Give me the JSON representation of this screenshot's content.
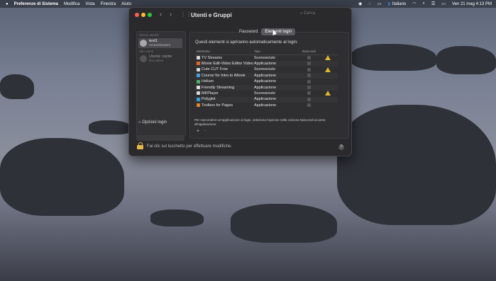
{
  "menubar": {
    "apple": "",
    "app": "Preferenze di Sistema",
    "menus": [
      "Modifica",
      "Vista",
      "Finestra",
      "Aiuto"
    ],
    "language": "Italiano",
    "datetime": "Ven 21 mag  4:13 PM"
  },
  "window": {
    "title": "Utenti e Gruppi",
    "search_placeholder": "Cerca"
  },
  "sidebar": {
    "current_users_header": "Utente attuale",
    "current_user": {
      "name": "test1",
      "role": "Amministratore"
    },
    "other_users_header": "Altri utenti",
    "guest_user": {
      "name": "Utente ospite",
      "role": "Non attivo"
    },
    "login_options": "Opzioni login"
  },
  "tabs": {
    "password": "Password",
    "login_items": "Elementi login"
  },
  "login_items": {
    "description": "Questi elementi si apriranno automaticamente al login:",
    "headers": {
      "item": "Elemento",
      "type": "Tipo",
      "hide": "Nascondi"
    },
    "rows": [
      {
        "name": "TV Streams",
        "type": "Sconosciuto",
        "warning": true,
        "icon_color": "#d8d8d8"
      },
      {
        "name": "Movie Edit-Video Editor Video",
        "type": "Applicazione",
        "warning": false,
        "icon_color": "#e06a2a"
      },
      {
        "name": "Cute CUT Free",
        "type": "Sconosciuto",
        "warning": true,
        "icon_color": "#d8d8d8"
      },
      {
        "name": "Course for Intro to iMovie",
        "type": "Applicazione",
        "warning": false,
        "icon_color": "#4a9be0"
      },
      {
        "name": "Helium",
        "type": "Applicazione",
        "warning": false,
        "icon_color": "#4fb36b"
      },
      {
        "name": "Friendly Streaming",
        "type": "Applicazione",
        "warning": false,
        "icon_color": "#e0e0e0"
      },
      {
        "name": "MKPlayer",
        "type": "Sconosciuto",
        "warning": true,
        "icon_color": "#d8d8d8"
      },
      {
        "name": "Polyglot",
        "type": "Applicazione",
        "warning": false,
        "icon_color": "#3aa0d8"
      },
      {
        "name": "Toolbox for Pages",
        "type": "Applicazione",
        "warning": false,
        "icon_color": "#e0842a"
      }
    ],
    "hint": "Per nascondere un'applicazione al login, seleziona l'opzione nella colonna Nascondi accanto all'applicazione.",
    "add": "+",
    "remove": "−"
  },
  "footer": {
    "lock_text": "Fai clic sul lucchetto per effettuare modifiche.",
    "help": "?"
  }
}
